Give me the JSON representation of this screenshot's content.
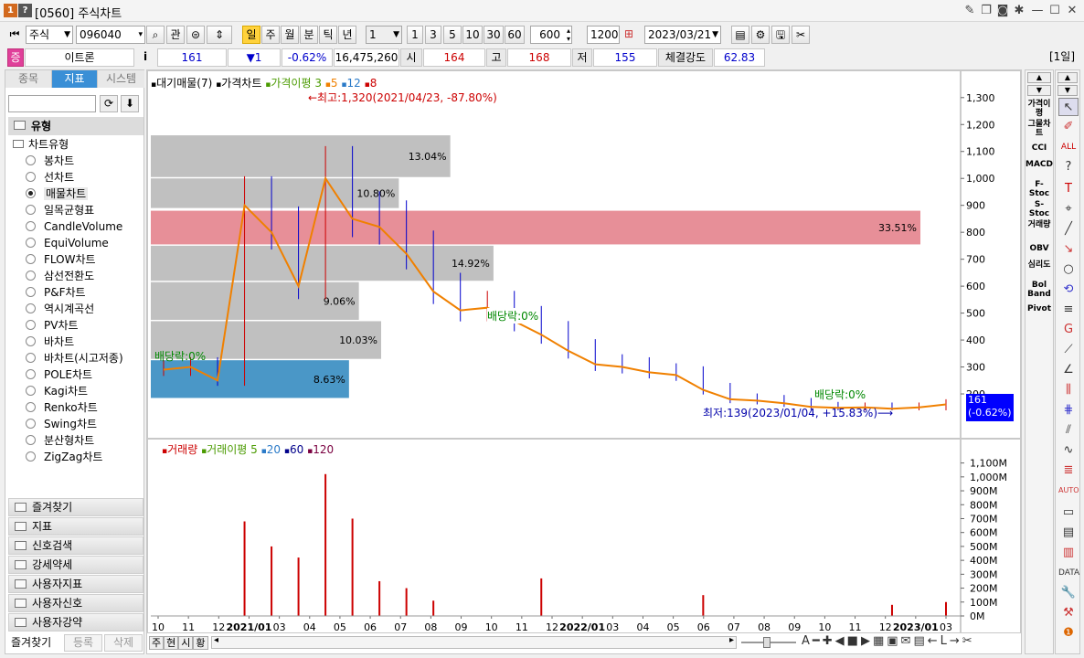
{
  "window": {
    "badge1": "1",
    "badge2": "?",
    "title": "[0560] 주식차트"
  },
  "toolbar": {
    "market_select": "주식",
    "code_input": "096040",
    "btn_gwan": "관",
    "periods": [
      "일",
      "주",
      "월",
      "분",
      "틱",
      "년"
    ],
    "selected_period": "일",
    "interval_select": "1",
    "intervals": [
      "1",
      "3",
      "5",
      "10",
      "30",
      "60"
    ],
    "count_input": "600",
    "separator": "/",
    "max_count": "1200",
    "date_input": "2023/03/21"
  },
  "quote": {
    "badge": "증",
    "name": "이트론",
    "info": "i",
    "price": "161",
    "change": "▼1",
    "change_rate": "-0.62%",
    "volume": "16,475,260",
    "open_label": "시",
    "open": "164",
    "high_label": "고",
    "high": "168",
    "low_label": "저",
    "low": "155",
    "strength_label": "체결강도",
    "strength": "62.83",
    "period_tag": "[1일]"
  },
  "sidebar": {
    "tabs": [
      "종목",
      "지표",
      "시스템"
    ],
    "selected_tab": "지표",
    "section": "유형",
    "subsection": "차트유형",
    "chart_types": [
      "봉차트",
      "선차트",
      "매물차트",
      "일목균형표",
      "CandleVolume",
      "EquiVolume",
      "FLOW차트",
      "삼선전환도",
      "P&F차트",
      "역시계곡선",
      "PV차트",
      "바차트",
      "바차트(시고저종)",
      "POLE차트",
      "Kagi차트",
      "Renko차트",
      "Swing차트",
      "분산형차트",
      "ZigZag차트"
    ],
    "selected_chart_type": "매물차트",
    "groups": [
      "즐겨찾기",
      "지표",
      "신호검색",
      "강세약세",
      "사용자지표",
      "사용자신호",
      "사용자강약"
    ],
    "footer": [
      "즐겨찾기",
      "등록",
      "삭제"
    ]
  },
  "price_panel": {
    "legend": [
      "대기매물(7)",
      "가격차트",
      "가격이평",
      "3",
      "5",
      "12",
      "8"
    ],
    "high_annotation": "←최고:1,320(2021/04/23, -87.80%)",
    "low_annotation": "최저:139(2023/01/04, +15.83%)⟶",
    "dividend_labels": [
      "배당락:0%",
      "배당락:0%",
      "배당락:0%"
    ],
    "current_price_label": "161",
    "current_rate_label": "(-0.62%)"
  },
  "volume_panel": {
    "legend": [
      "거래량",
      "거래이평",
      "5",
      "20",
      "60",
      "120"
    ]
  },
  "chart_data": [
    {
      "type": "line",
      "title": "",
      "y_axis": {
        "ticks": [
          200,
          300,
          400,
          500,
          600,
          700,
          800,
          900,
          1000,
          1100,
          1200,
          1300
        ],
        "labels": [
          "200",
          "300",
          "400",
          "500",
          "600",
          "700",
          "800",
          "900",
          "1,000",
          "1,100",
          "1,200",
          "1,300"
        ],
        "ylim": [
          139,
          1340
        ]
      },
      "x_axis": {
        "labels": [
          "10",
          "11",
          "12",
          "2021/01",
          "03",
          "04",
          "05",
          "06",
          "07",
          "08",
          "09",
          "10",
          "11",
          "12",
          "2022/01",
          "03",
          "04",
          "05",
          "06",
          "07",
          "08",
          "09",
          "10",
          "11",
          "12",
          "2023/01",
          "03"
        ]
      },
      "series": [
        {
          "name": "가격이평",
          "x": [
            "2020-10",
            "2020-11",
            "2020-12",
            "2021-01",
            "2021-02",
            "2021-03",
            "2021-04",
            "2021-05",
            "2021-06",
            "2021-07",
            "2021-08",
            "2021-09",
            "2021-10",
            "2021-11",
            "2021-12",
            "2022-01",
            "2022-02",
            "2022-03",
            "2022-04",
            "2022-05",
            "2022-06",
            "2022-07",
            "2022-08",
            "2022-09",
            "2022-10",
            "2022-11",
            "2022-12",
            "2023-01",
            "2023-02",
            "2023-03"
          ],
          "values": [
            290,
            300,
            250,
            900,
            800,
            600,
            1000,
            850,
            820,
            720,
            580,
            510,
            520,
            470,
            420,
            360,
            310,
            300,
            280,
            270,
            215,
            180,
            175,
            165,
            152,
            148,
            150,
            145,
            150,
            161
          ]
        }
      ],
      "volume_profile": {
        "name": "대기매물",
        "bands": [
          {
            "from": 1005,
            "to": 1160,
            "pct": "13.04%",
            "percent": 13.04
          },
          {
            "from": 890,
            "to": 1000,
            "pct": "10.80%",
            "percent": 10.8
          },
          {
            "from": 755,
            "to": 880,
            "pct": "33.51%",
            "percent": 33.51
          },
          {
            "from": 620,
            "to": 750,
            "pct": "14.92%",
            "percent": 14.92
          },
          {
            "from": 475,
            "to": 615,
            "pct": "9.06%",
            "percent": 9.06
          },
          {
            "from": 330,
            "to": 470,
            "pct": "10.03%",
            "percent": 10.03
          },
          {
            "from": 185,
            "to": 325,
            "pct": "8.63%",
            "percent": 8.63
          }
        ],
        "highlighted_band": "33.51%",
        "current_band": "8.63%"
      }
    },
    {
      "type": "bar",
      "title": "",
      "y_axis": {
        "ticks": [
          0,
          100,
          200,
          300,
          400,
          500,
          600,
          700,
          800,
          900,
          1000,
          1100
        ],
        "labels": [
          "0M",
          "100M",
          "200M",
          "300M",
          "400M",
          "500M",
          "600M",
          "700M",
          "800M",
          "900M",
          "1,000M",
          "1,100M"
        ],
        "ylim": [
          0,
          1150
        ]
      },
      "series": [
        {
          "name": "거래량",
          "x": [
            "2021-01",
            "2021-02",
            "2021-03",
            "2021-04",
            "2021-05",
            "2021-06",
            "2021-07",
            "2021-08",
            "2021-12",
            "2022-06",
            "2023-01",
            "2023-03"
          ],
          "values": [
            680,
            500,
            420,
            1020,
            700,
            250,
            200,
            110,
            270,
            150,
            80,
            100
          ]
        }
      ]
    }
  ],
  "colors": {
    "accent": "#ffd23c",
    "down": "#0000cc",
    "up": "#cc0000",
    "band_gray": "#c0c0c0",
    "band_red": "#e78f98",
    "band_blue": "#4a97c7",
    "price_tag": "#0000ff"
  },
  "bottom_bar": {
    "buttons": [
      "주",
      "현",
      "시",
      "황"
    ]
  },
  "indicators": [
    "가격이평",
    "그물차트",
    "CCI",
    "MACD",
    "F-Stoc",
    "S-Stoc",
    "거래량",
    "OBV",
    "심리도",
    "Bol Band",
    "Pivot"
  ]
}
